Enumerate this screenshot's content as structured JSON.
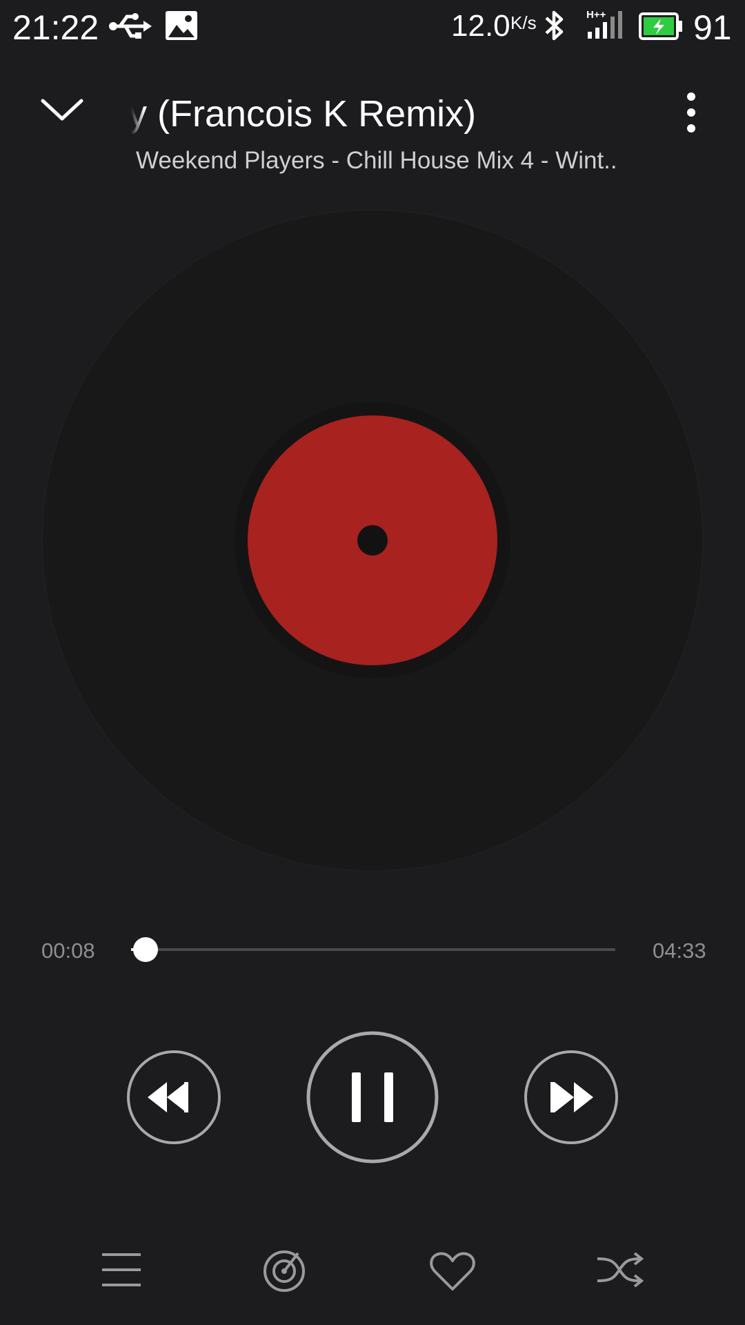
{
  "status_bar": {
    "time": "21:22",
    "net_speed": "12.0",
    "net_speed_unit": "K/s",
    "network_type": "H++",
    "battery_level": "91",
    "icons": [
      "usb-icon",
      "image-icon",
      "bluetooth-icon",
      "signal-icon",
      "battery-charging-icon"
    ]
  },
  "header": {
    "title": "ury (Francois K Remix)",
    "subtitle": "Weekend Players - Chill House Mix 4 - Wint..",
    "icons": [
      "chevron-down-icon",
      "more-vert-icon"
    ]
  },
  "player": {
    "label_color": "#a8221f",
    "elapsed": "00:08",
    "total": "04:33",
    "progress": 0.03
  },
  "controls": {
    "icons": [
      "rewind-icon",
      "pause-icon",
      "fast-forward-icon"
    ]
  },
  "bottom_bar": {
    "icons": [
      "playlist-icon",
      "radar-icon",
      "heart-icon",
      "shuffle-icon"
    ]
  }
}
